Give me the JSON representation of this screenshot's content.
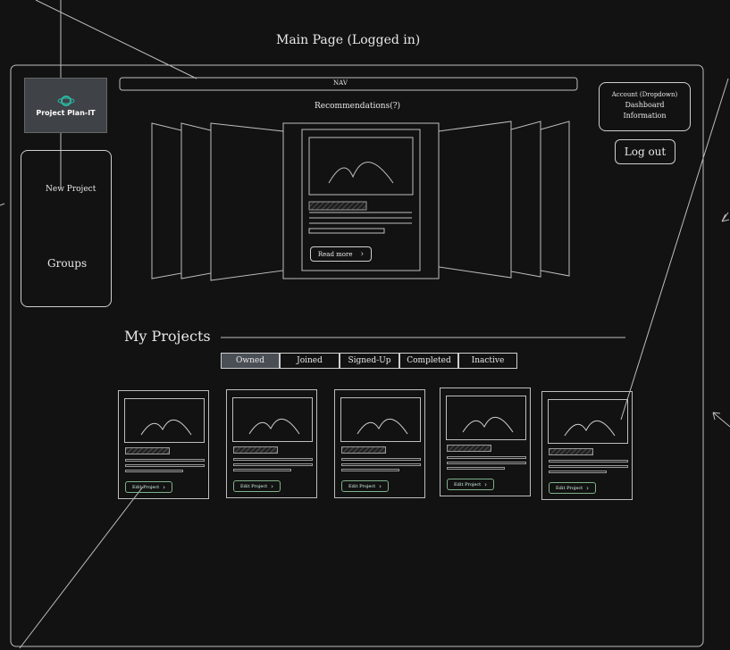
{
  "page_title": "Main Page (Logged in)",
  "nav_label": "NAV",
  "logo_text": "Project Plan-IT",
  "sidebar": {
    "new_project": "New Project",
    "groups": "Groups"
  },
  "recommendations": {
    "title": "Recommendations(?)",
    "read_more": "Read more"
  },
  "account": {
    "line1": "Account (Dropdown)",
    "line2": "Dashboard",
    "line3": "Information"
  },
  "logout_label": "Log out",
  "my_projects": {
    "heading": "My Projects",
    "tabs": [
      "Owned",
      "Joined",
      "Signed-Up",
      "Completed",
      "Inactive"
    ],
    "active_tab": "Owned",
    "edit_label": "Edit Project"
  },
  "colors": {
    "background": "#121212",
    "stroke": "#cfcfcf",
    "logo_bg": "#3f4246",
    "logo_accent": "#2bb5a0",
    "edit_button_stroke": "#7fb08a"
  }
}
